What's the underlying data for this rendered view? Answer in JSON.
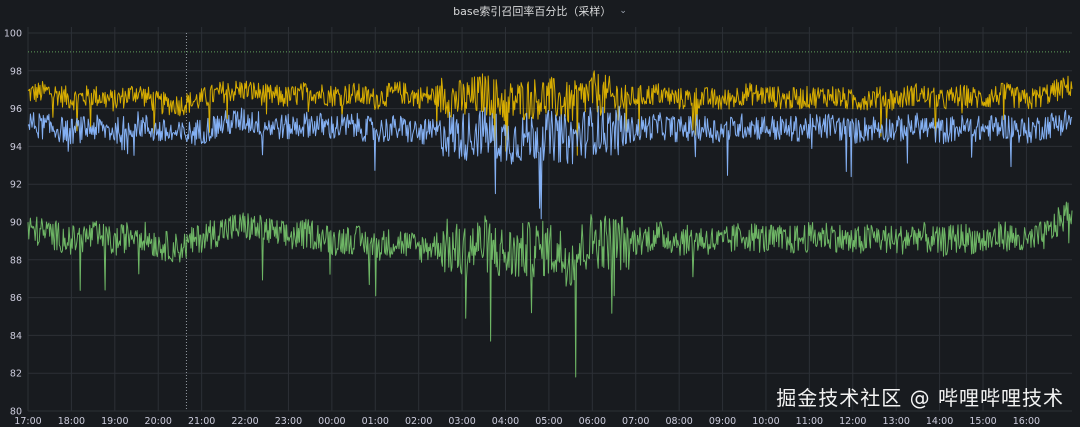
{
  "panel": {
    "title": "base索引召回率百分比（采样）",
    "menu_icon": "chevron-down-icon"
  },
  "watermark": "掘金技术社区 @ 哔哩哔哩技术",
  "chart_data": {
    "type": "line",
    "title": "base索引召回率百分比（采样）",
    "xlabel": "",
    "ylabel": "",
    "ylim": [
      80,
      100
    ],
    "grid": true,
    "legend": "none",
    "y_ticks": [
      "80",
      "82",
      "84",
      "86",
      "88",
      "90",
      "92",
      "94",
      "96",
      "98",
      "100"
    ],
    "x_ticks": [
      "17:00",
      "18:00",
      "19:00",
      "20:00",
      "21:00",
      "22:00",
      "23:00",
      "00:00",
      "01:00",
      "02:00",
      "03:00",
      "04:00",
      "05:00",
      "06:00",
      "07:00",
      "08:00",
      "09:00",
      "10:00",
      "11:00",
      "12:00",
      "13:00",
      "14:00",
      "15:00",
      "16:00"
    ],
    "x_hours": [
      0,
      1,
      2,
      3,
      4,
      5,
      6,
      7,
      8,
      9,
      10,
      11,
      12,
      13,
      14,
      15,
      16,
      17,
      18,
      19,
      20,
      21,
      22,
      23
    ],
    "x_range_hours": [
      0,
      24.05
    ],
    "threshold": {
      "value": 99,
      "color": "#73bf69"
    },
    "cursor_time_hours": 3.65,
    "series": [
      {
        "color": "#e0b400",
        "x_hours": [
          0,
          0.5,
          1,
          1.5,
          2,
          2.5,
          3,
          3.5,
          4,
          4.5,
          5,
          5.5,
          6,
          6.5,
          7,
          7.5,
          8,
          8.5,
          9,
          9.5,
          10,
          10.5,
          11,
          11.5,
          12,
          12.5,
          13,
          13.5,
          14,
          14.5,
          15,
          15.5,
          16,
          16.5,
          17,
          17.5,
          18,
          18.5,
          19,
          19.5,
          20,
          20.5,
          21,
          21.5,
          22,
          22.5,
          23,
          23.5,
          24
        ],
        "values": [
          96.8,
          96.9,
          96.5,
          96.7,
          96.4,
          96.9,
          96.3,
          96.2,
          96.5,
          96.9,
          97.0,
          96.7,
          96.6,
          96.9,
          96.7,
          96.8,
          96.5,
          96.9,
          96.6,
          96.7,
          96.4,
          96.8,
          96.3,
          96.5,
          96.6,
          96.2,
          96.9,
          96.5,
          96.6,
          96.8,
          96.5,
          96.6,
          96.4,
          96.8,
          96.7,
          96.5,
          96.6,
          96.7,
          96.4,
          96.6,
          96.5,
          96.8,
          96.4,
          96.7,
          96.5,
          96.8,
          96.4,
          96.8,
          97.2
        ],
        "noise": 0.6
      },
      {
        "color": "#8ab8ff",
        "x_hours": [
          0,
          0.5,
          1,
          1.5,
          2,
          2.5,
          3,
          3.5,
          4,
          4.5,
          5,
          5.5,
          6,
          6.5,
          7,
          7.5,
          8,
          8.5,
          9,
          9.5,
          10,
          10.5,
          11,
          11.5,
          12,
          12.5,
          13,
          13.5,
          14,
          14.5,
          15,
          15.5,
          16,
          16.5,
          17,
          17.5,
          18,
          18.5,
          19,
          19.5,
          20,
          20.5,
          21,
          21.5,
          22,
          22.5,
          23,
          23.5,
          24
        ],
        "values": [
          95.2,
          95.0,
          94.8,
          95.0,
          94.8,
          95.2,
          94.8,
          94.6,
          94.8,
          95.2,
          95.4,
          95.1,
          95.0,
          95.2,
          95.0,
          95.1,
          94.8,
          95.0,
          94.7,
          94.8,
          94.5,
          94.8,
          94.3,
          94.5,
          94.6,
          94.3,
          94.9,
          94.8,
          94.9,
          95.1,
          94.9,
          95.0,
          94.8,
          95.1,
          95.0,
          94.9,
          95.0,
          95.1,
          94.8,
          95.0,
          94.9,
          95.1,
          94.8,
          95.0,
          94.9,
          95.1,
          94.8,
          95.1,
          95.4
        ],
        "noise": 0.7
      },
      {
        "color": "#73bf69",
        "x_hours": [
          0,
          0.5,
          1,
          1.5,
          2,
          2.5,
          3,
          3.5,
          4,
          4.5,
          5,
          5.5,
          6,
          6.5,
          7,
          7.5,
          8,
          8.5,
          9,
          9.5,
          10,
          10.5,
          11,
          11.5,
          12,
          12.5,
          13,
          13.5,
          14,
          14.5,
          15,
          15.5,
          16,
          16.5,
          17,
          17.5,
          18,
          18.5,
          19,
          19.5,
          20,
          20.5,
          21,
          21.5,
          22,
          22.5,
          23,
          23.5,
          24
        ],
        "values": [
          89.6,
          89.4,
          89.0,
          89.3,
          88.9,
          89.5,
          88.8,
          88.6,
          89.2,
          89.6,
          89.8,
          89.5,
          89.2,
          89.4,
          89.0,
          89.1,
          88.7,
          89.0,
          88.6,
          88.8,
          88.4,
          88.9,
          88.2,
          88.5,
          88.6,
          88.0,
          89.1,
          88.9,
          89.0,
          89.3,
          89.0,
          89.1,
          88.9,
          89.3,
          89.1,
          89.0,
          89.2,
          89.3,
          88.9,
          89.2,
          89.0,
          89.3,
          88.9,
          89.2,
          89.0,
          89.3,
          88.9,
          89.4,
          90.6
        ],
        "noise": 0.8,
        "outliers": [
          {
            "x_hours": 10.65,
            "value": 83.7
          },
          {
            "x_hours": 11.6,
            "value": 85.2
          },
          {
            "x_hours": 12.62,
            "value": 81.8
          },
          {
            "x_hours": 13.5,
            "value": 86.1
          }
        ]
      }
    ]
  }
}
